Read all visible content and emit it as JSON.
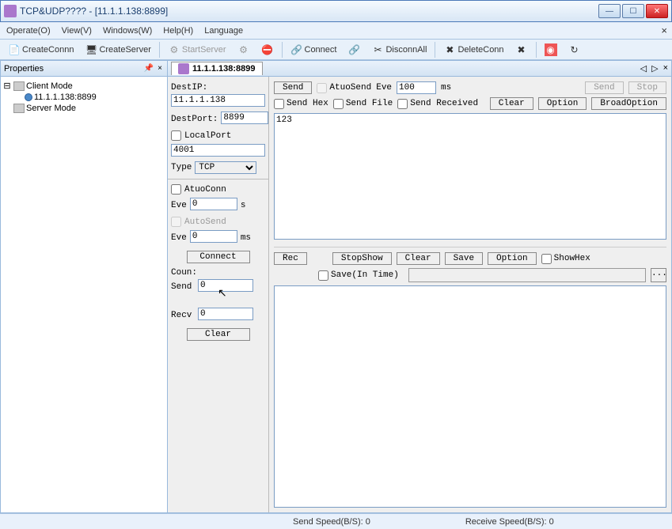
{
  "window": {
    "title": "TCP&UDP???? - [11.1.1.138:8899]"
  },
  "menu": {
    "operate": "Operate(O)",
    "view": "View(V)",
    "windows": "Windows(W)",
    "help": "Help(H)",
    "language": "Language"
  },
  "toolbar": {
    "createConn": "CreateConnn",
    "createServer": "CreateServer",
    "startServer": "StartServer",
    "connect": "Connect",
    "disconAll": "DisconnAll",
    "deleteConn": "DeleteConn"
  },
  "properties": {
    "title": "Properties",
    "clientMode": "Client Mode",
    "connection": "11.1.1.138:8899",
    "serverMode": "Server Mode"
  },
  "tab": {
    "title": "11.1.1.138:8899"
  },
  "params": {
    "destIpLabel": "DestIP:",
    "destIp": "11.1.1.138",
    "destPortLabel": "DestPort:",
    "destPort": "8899",
    "localPortLabel": "LocalPort",
    "localPort": "4001",
    "typeLabel": "Type",
    "type": "TCP",
    "atuoConn": "AtuoConn",
    "eveLabel": "Eve",
    "eveConn": "0",
    "eveConnUnit": "s",
    "autoSend": "AutoSend",
    "eveSend": "0",
    "eveSendUnit": "ms",
    "connectBtn": "Connect",
    "counLabel": "Coun:",
    "sendLabel": "Send",
    "sendCount": "0",
    "recvLabel": "Recv",
    "recvCount": "0",
    "clearBtn": "Clear"
  },
  "send": {
    "sendBtn": "Send",
    "atuoSend": "AtuoSend",
    "eveLabel": "Eve",
    "eveVal": "100",
    "eveUnit": "ms",
    "send2": "Send",
    "stop": "Stop",
    "sendHex": "Send Hex",
    "sendFile": "Send File",
    "sendReceived": "Send Received",
    "clear": "Clear",
    "option": "Option",
    "broadOption": "BroadOption",
    "text": "123"
  },
  "recv": {
    "rec": "Rec",
    "stopShow": "StopShow",
    "clear": "Clear",
    "save": "Save",
    "option": "Option",
    "showHex": "ShowHex",
    "saveInTime": "Save(In Time)",
    "browse": "...",
    "text": ""
  },
  "status": {
    "sendSpeed": "Send Speed(B/S): 0",
    "recvSpeed": "Receive Speed(B/S): 0"
  }
}
